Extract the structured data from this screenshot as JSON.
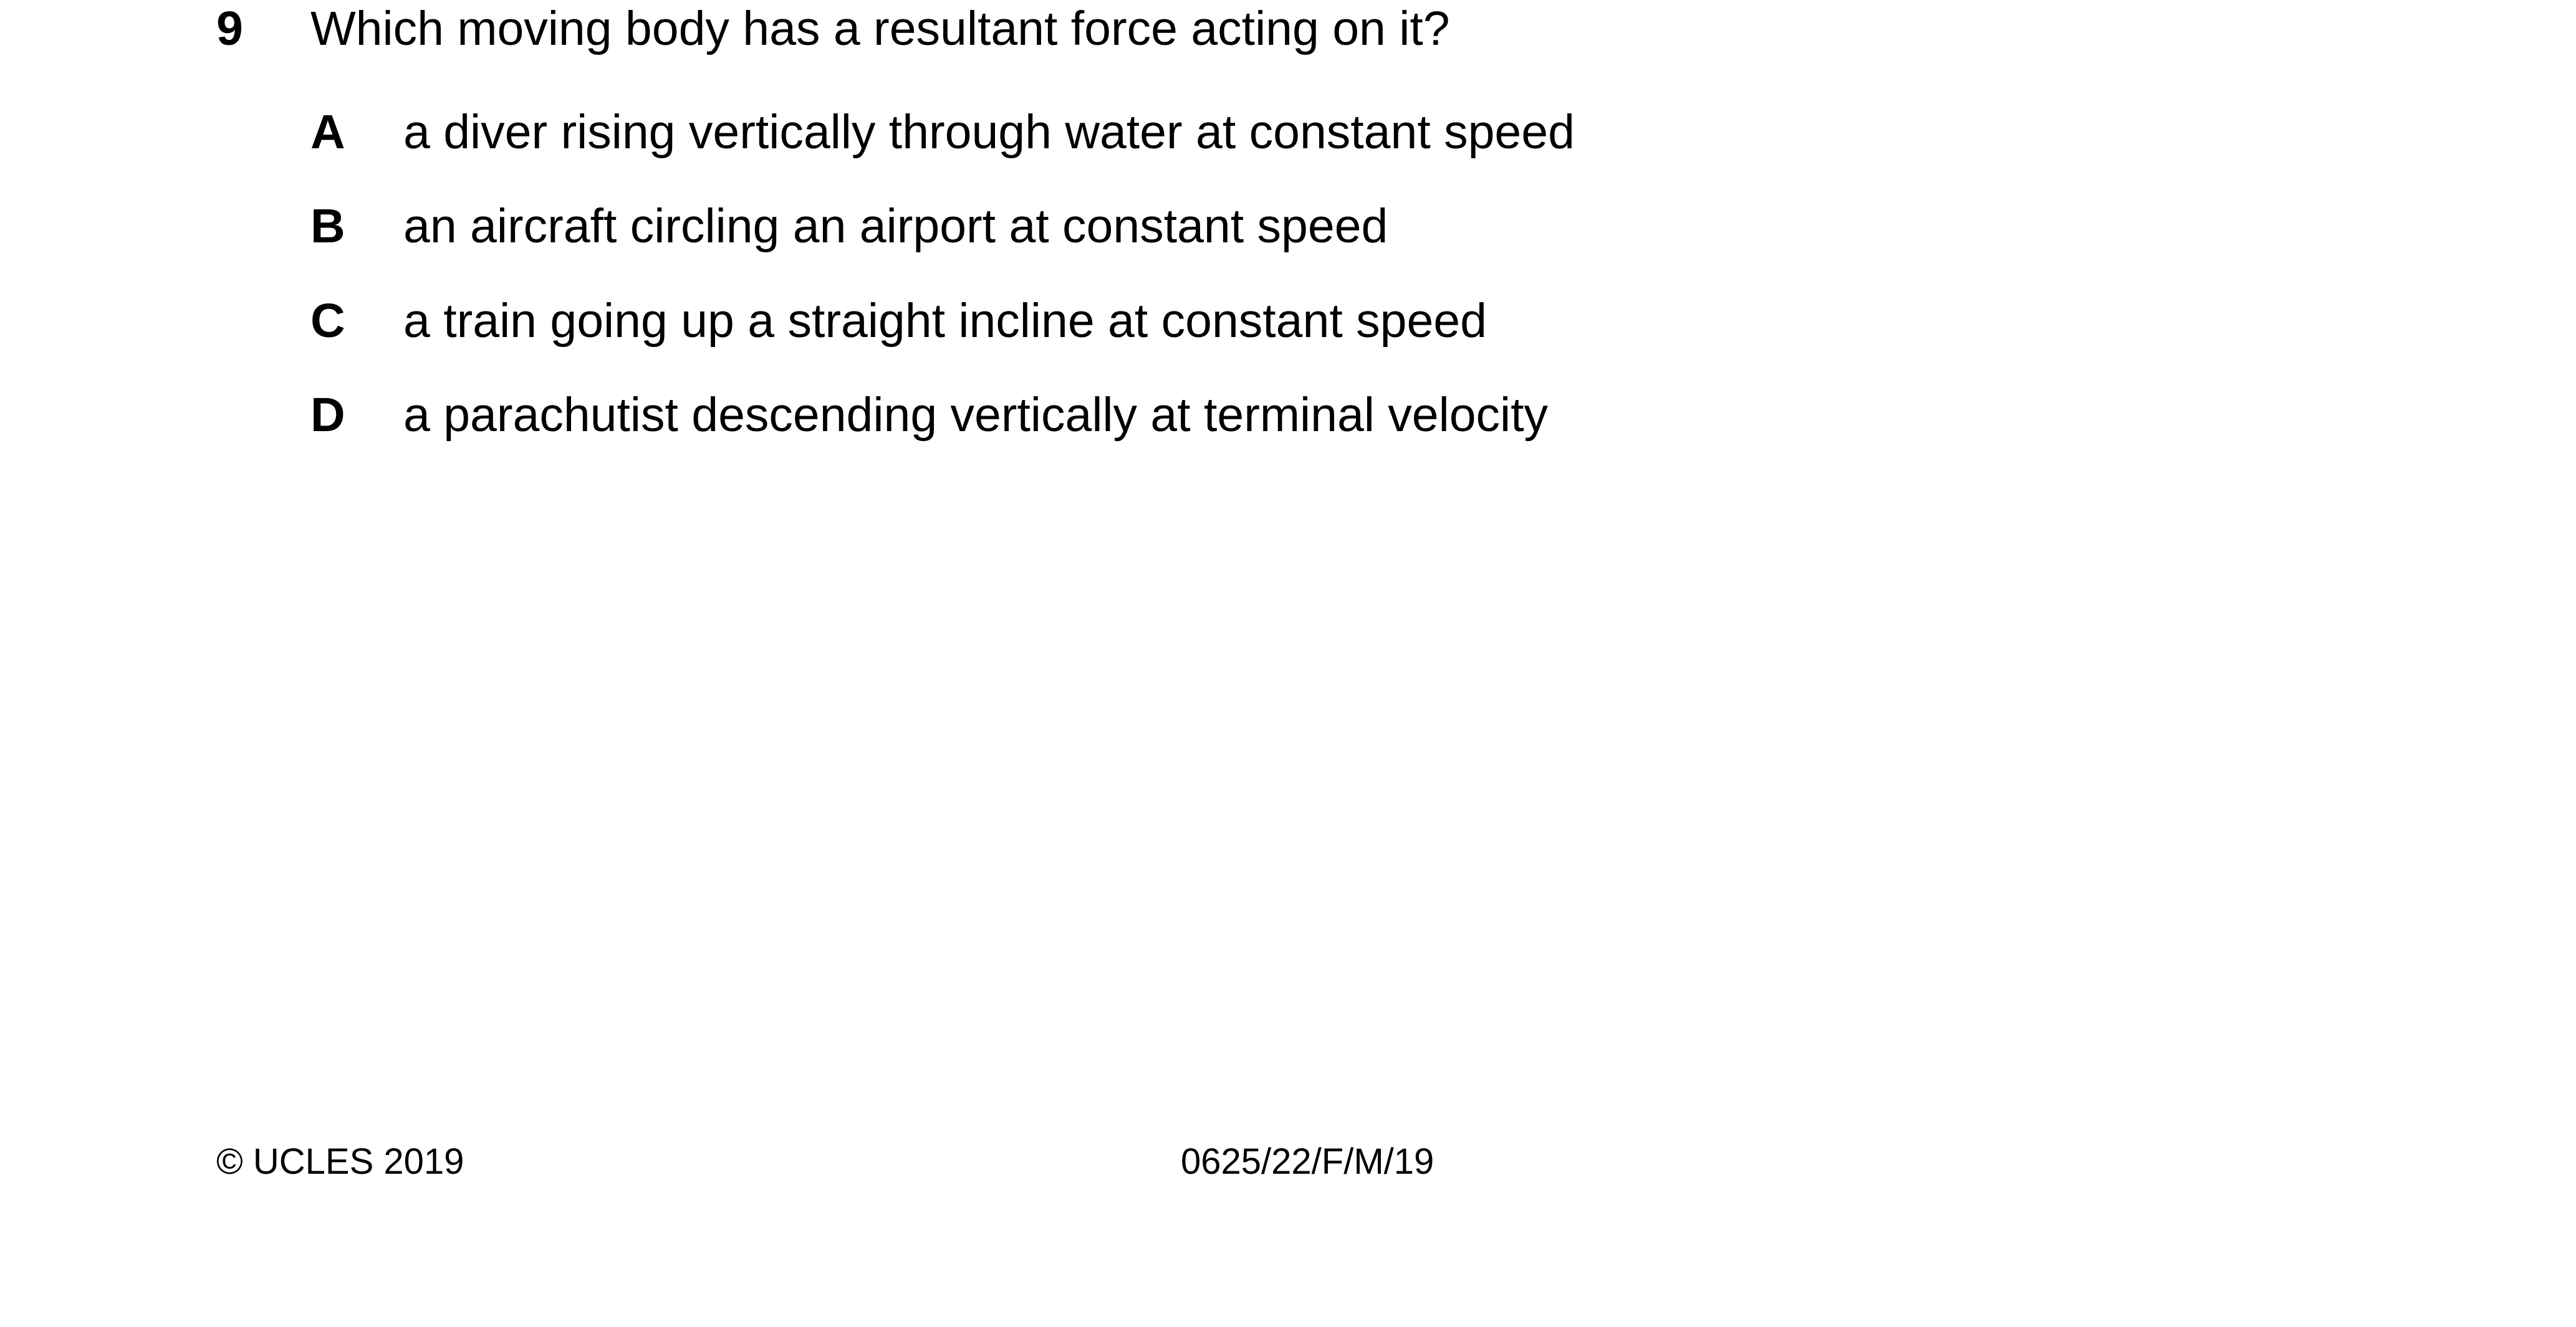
{
  "question": {
    "number": "9",
    "text": "Which moving body has a resultant force acting on it?",
    "options": [
      {
        "letter": "A",
        "text": "a diver rising vertically through water at constant speed"
      },
      {
        "letter": "B",
        "text": "an aircraft circling an airport at constant speed"
      },
      {
        "letter": "C",
        "text": "a train going up a straight incline at constant speed"
      },
      {
        "letter": "D",
        "text": "a parachutist descending vertically at terminal velocity"
      }
    ]
  },
  "footer": {
    "copyright": "© UCLES 2019",
    "paper_code": "0625/22/F/M/19"
  }
}
